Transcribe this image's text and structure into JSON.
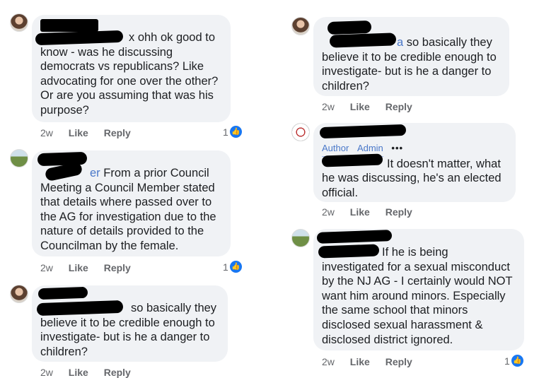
{
  "labels": {
    "time": "2w",
    "like": "Like",
    "reply": "Reply"
  },
  "comments": [
    {
      "lines": [
        "x ohh ok good to",
        "know - was he discussing",
        "democrats vs republicans? Like",
        "advocating for one over the other?",
        "Or are you assuming that was his",
        "purpose?"
      ],
      "reactions": "1"
    },
    {
      "lines": [
        "er From a prior Council",
        "Meeting a Council Member stated",
        "that details where passed over to",
        "the AG for investigation due to the",
        "nature of details provided to the",
        "Councilman by the female."
      ],
      "reactions": "1"
    },
    {
      "lines": [
        "so basically they",
        "believe it to be credible enough to",
        "investigate- but is he a danger to",
        "children?"
      ]
    },
    {
      "lines": [
        "a so basically they",
        "believe it to be credible enough to",
        "investigate- but is he a danger to",
        "children?"
      ]
    },
    {
      "badges": [
        "Author",
        "Admin"
      ],
      "more": "•••",
      "lines": [
        "It doesn't matter, what",
        "he was discussing, he's an elected",
        "official."
      ]
    },
    {
      "lines": [
        "If he is being",
        "investigated for a sexual misconduct",
        "by the NJ AG - I certainly would NOT",
        "want him around minors.  Especially",
        "the same school that minors",
        "disclosed sexual harassment &",
        "disclosed district ignored."
      ],
      "reactions": "1"
    }
  ],
  "icons": {
    "like_badge": "thumbs-up-icon",
    "more": "more-icon"
  },
  "colors": {
    "bubble": "#f0f2f5",
    "link": "#4a78c9",
    "like_blue": "#1877f2",
    "meta": "#65676b"
  }
}
